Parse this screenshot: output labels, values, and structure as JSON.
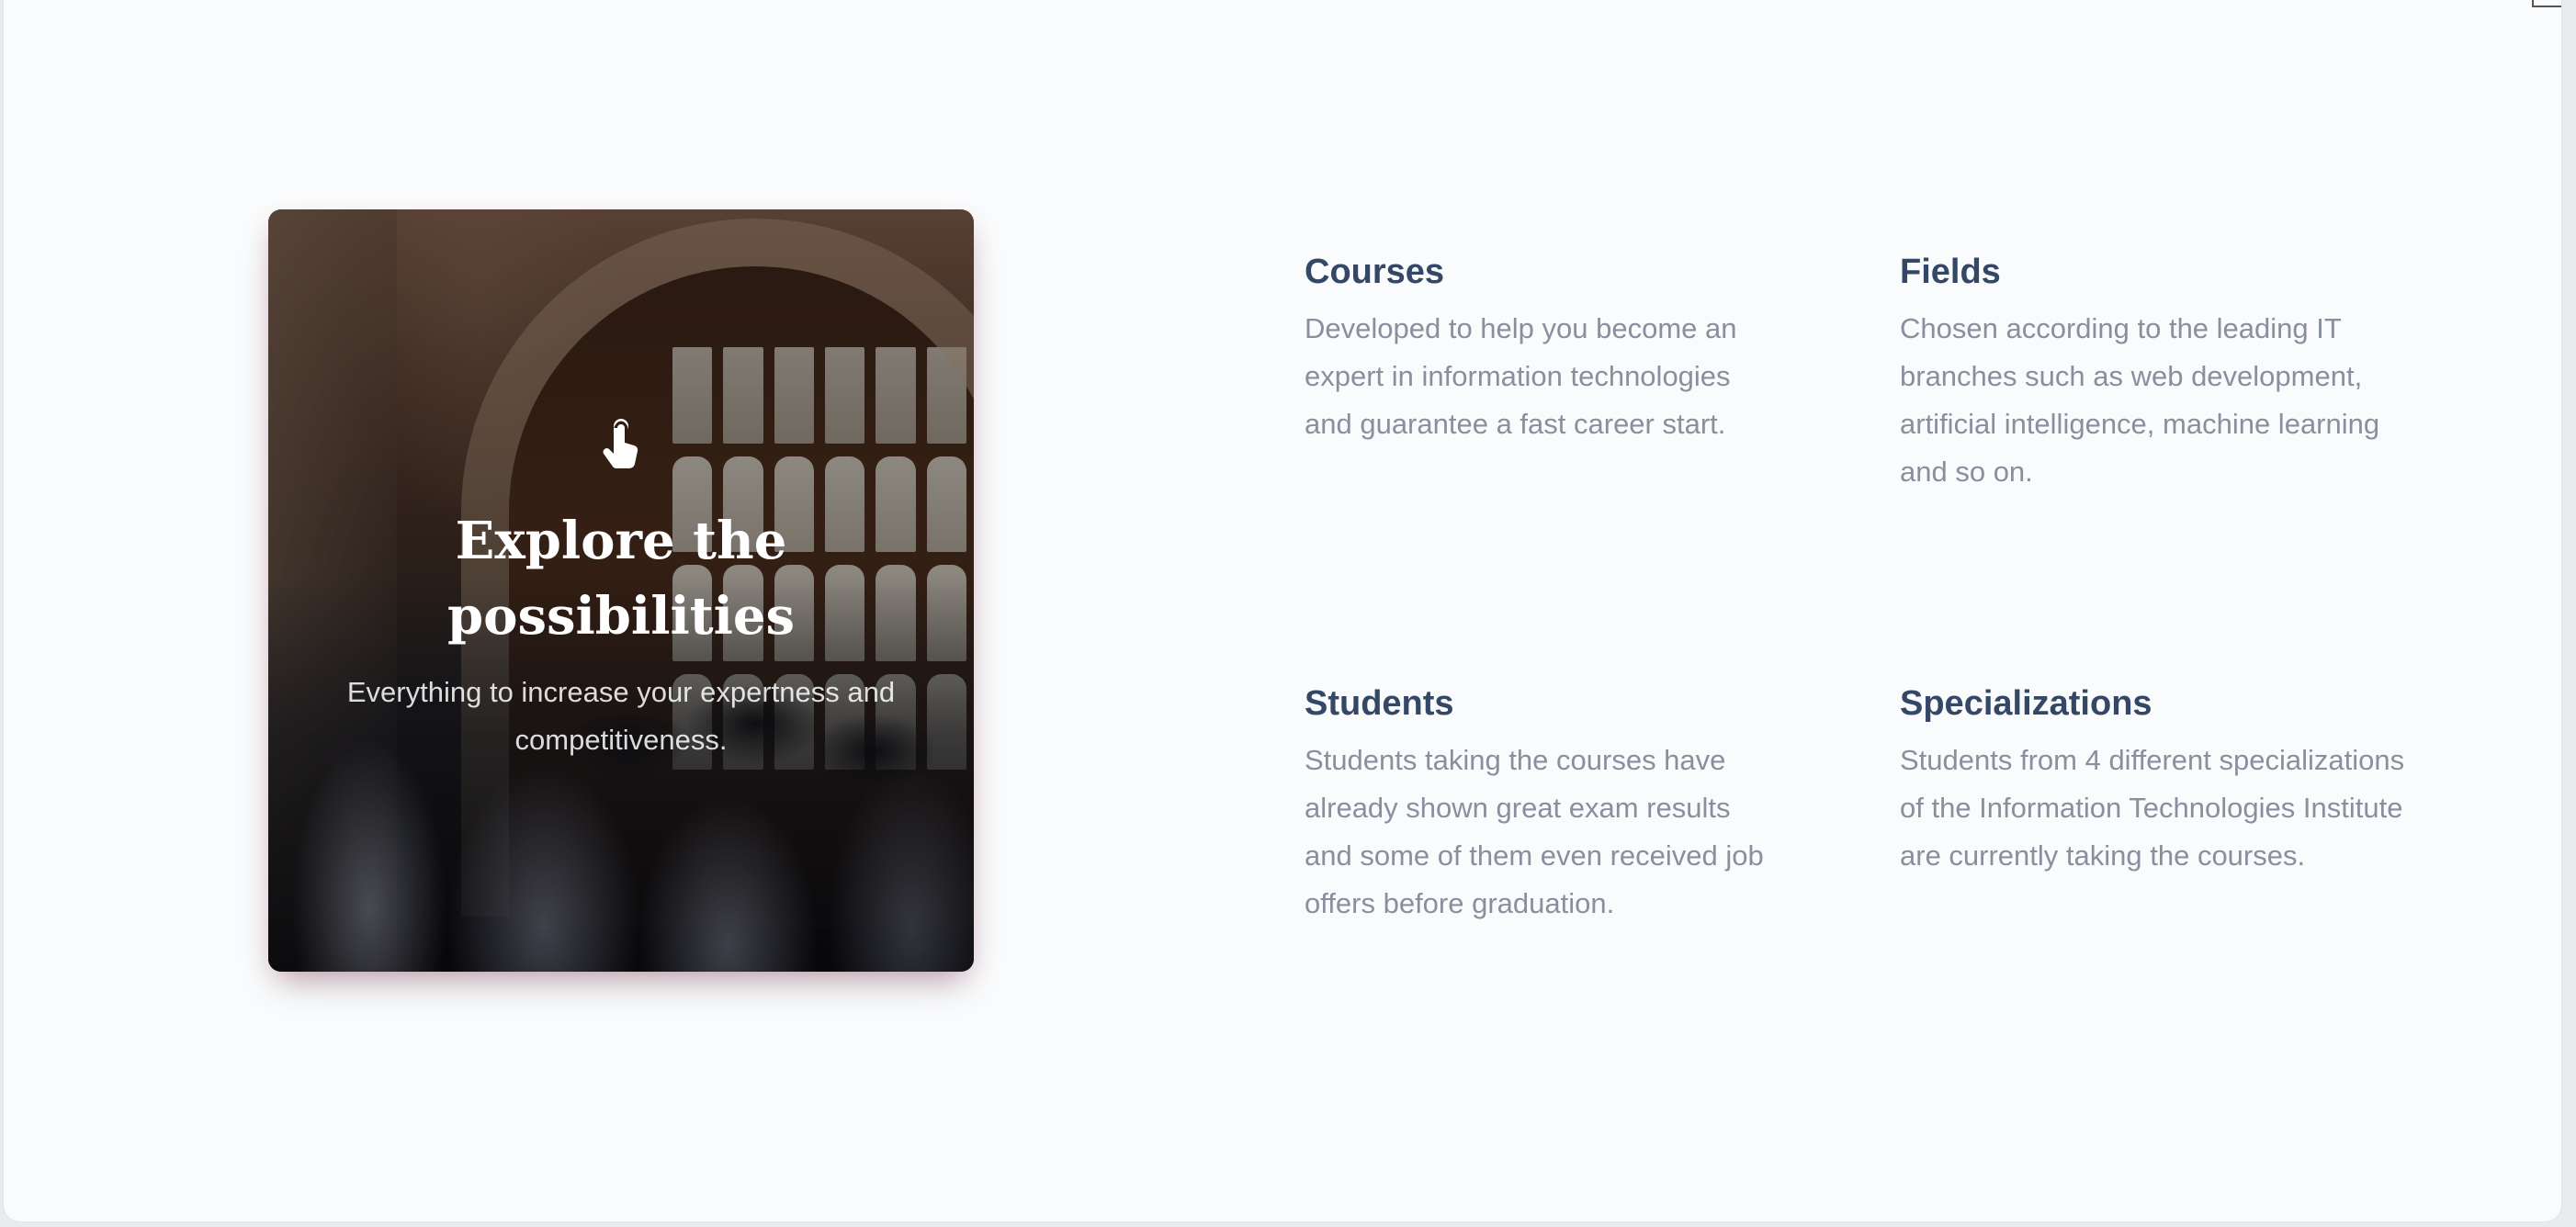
{
  "hero": {
    "icon": "touch-app-icon",
    "title": "Explore the possibilities",
    "subtitle": "Everything to increase your expertness and competitiveness."
  },
  "features": [
    {
      "title": "Courses",
      "text": "Developed to help you become an expert in information technologies and guarantee a fast career start."
    },
    {
      "title": "Fields",
      "text": "Chosen according to the leading IT branches such as web development, artificial intelligence, machine learning and so on."
    },
    {
      "title": "Students",
      "text": "Students taking the courses have already shown great exam results and some of them even received job offers before graduation."
    },
    {
      "title": "Specializations",
      "text": "Students from 4 different specializations of the Information Technologies Institute are currently taking the courses."
    }
  ],
  "colors": {
    "heading": "#344767",
    "body_text": "#8a8f9e",
    "background": "#fafbfc"
  }
}
